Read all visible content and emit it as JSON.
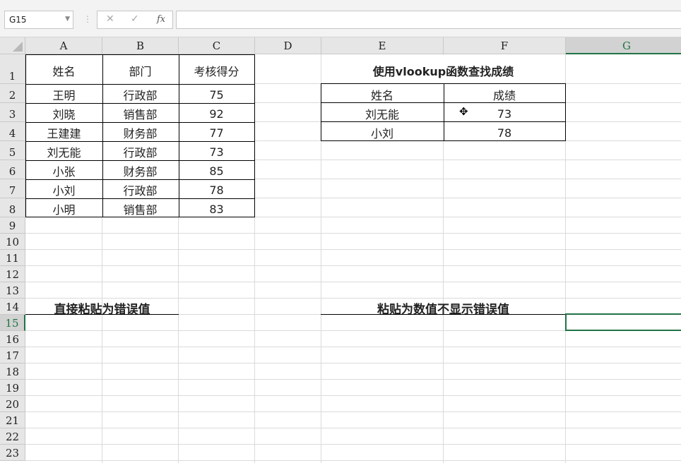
{
  "formula_bar": {
    "name_box": "G15",
    "cancel_symbol": "✕",
    "confirm_symbol": "✓",
    "fx_label": "fx",
    "formula": ""
  },
  "columns": [
    "A",
    "B",
    "C",
    "D",
    "E",
    "F",
    "G"
  ],
  "selected_column": "G",
  "rows": [
    "1",
    "2",
    "3",
    "4",
    "5",
    "6",
    "7",
    "8",
    "9",
    "10",
    "11",
    "12",
    "13",
    "14",
    "15",
    "16",
    "17",
    "18",
    "19",
    "20",
    "21",
    "22",
    "23"
  ],
  "selected_row": "15",
  "source_table": {
    "headers": [
      "姓名",
      "部门",
      "考核得分"
    ],
    "rows": [
      [
        "王明",
        "行政部",
        "75"
      ],
      [
        "刘晓",
        "销售部",
        "92"
      ],
      [
        "王建建",
        "财务部",
        "77"
      ],
      [
        "刘无能",
        "行政部",
        "73"
      ],
      [
        "小张",
        "财务部",
        "85"
      ],
      [
        "小刘",
        "行政部",
        "78"
      ],
      [
        "小明",
        "销售部",
        "83"
      ]
    ]
  },
  "lookup": {
    "title": "使用vlookup函数查找成绩",
    "headers": [
      "姓名",
      "成绩"
    ],
    "rows": [
      [
        "刘无能",
        "73"
      ],
      [
        "小刘",
        "78"
      ]
    ]
  },
  "labels": {
    "paste_error": "直接粘贴为错误值",
    "paste_value": "粘贴为数值不显示错误值"
  }
}
